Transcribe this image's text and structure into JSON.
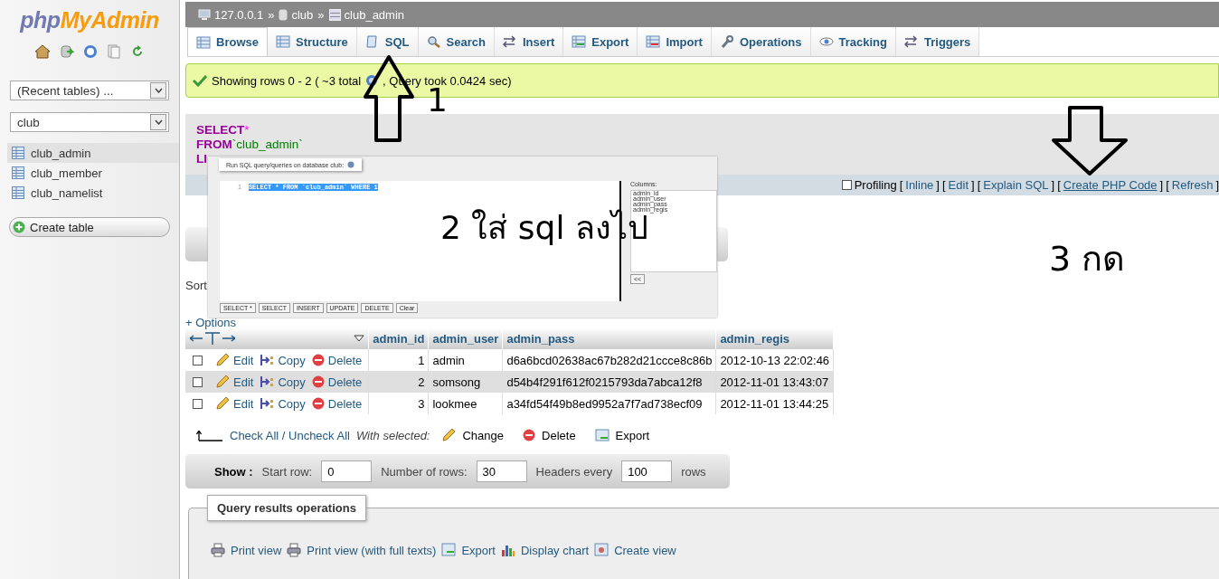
{
  "sidebar": {
    "logo": [
      "php",
      "MyAdmin"
    ],
    "recent_tables": "(Recent tables) ...",
    "database": "club",
    "tables": [
      {
        "name": "club_admin",
        "selected": true
      },
      {
        "name": "club_member",
        "selected": false
      },
      {
        "name": "club_namelist",
        "selected": false
      }
    ],
    "create_table": "Create table"
  },
  "breadcrumb": {
    "separator": "»",
    "items": [
      "127.0.0.1",
      "club",
      "club_admin"
    ]
  },
  "tabs": [
    {
      "label": "Browse",
      "selected": true
    },
    {
      "label": "Structure",
      "selected": false
    },
    {
      "label": "SQL",
      "selected": false
    },
    {
      "label": "Search",
      "selected": false
    },
    {
      "label": "Insert",
      "selected": false
    },
    {
      "label": "Export",
      "selected": false
    },
    {
      "label": "Import",
      "selected": false
    },
    {
      "label": "Operations",
      "selected": false
    },
    {
      "label": "Tracking",
      "selected": false
    },
    {
      "label": "Triggers",
      "selected": false
    }
  ],
  "message": {
    "before": "Showing rows 0 - 2 ( ~3 total",
    "after": ", Query took 0.0424 sec)"
  },
  "sql": {
    "lines": [
      {
        "keyword": "SELECT",
        "rest": "*"
      },
      {
        "keyword": "FROM",
        "rest": "`club_admin`"
      },
      {
        "keyword": "LI"
      }
    ],
    "profiling": {
      "label": "Profiling",
      "checked": false
    },
    "links": [
      {
        "open": "[",
        "label": "Inline",
        "close": "]"
      },
      {
        "open": "[",
        "label": "Edit",
        "close": "]"
      },
      {
        "open": "[",
        "label": "Explain SQL",
        "close": "]"
      },
      {
        "open": "[",
        "label": "Create PHP Code",
        "close": "]"
      },
      {
        "open": "[",
        "label": "Refresh",
        "close": "]"
      }
    ]
  },
  "sort_label": "Sort",
  "options_link": "+ Options",
  "table": {
    "columns": [
      "admin_id",
      "admin_user",
      "admin_pass",
      "admin_regis"
    ],
    "rows": [
      {
        "checked": false,
        "actions": [
          "Edit",
          "Copy",
          "Delete"
        ],
        "cells": [
          "1",
          "admin",
          "d6a6bcd02638ac67b282d21ccce8c86b",
          "2012-10-13 22:02:46"
        ]
      },
      {
        "checked": false,
        "actions": [
          "Edit",
          "Copy",
          "Delete"
        ],
        "cells": [
          "2",
          "somsong",
          "d54b4f291f612f0215793da7abca12f8",
          "2012-11-01 13:43:07"
        ]
      },
      {
        "checked": false,
        "actions": [
          "Edit",
          "Copy",
          "Delete"
        ],
        "cells": [
          "3",
          "lookmee",
          "a34fd54f49b8ed9952a7f7ad738ecf09",
          "2012-11-01 13:44:25"
        ]
      }
    ]
  },
  "bulk": {
    "check_all": "Check All / Uncheck All",
    "with_selected": "With selected:",
    "actions": [
      "Change",
      "Delete",
      "Export"
    ]
  },
  "show_bar": {
    "label": "Show :",
    "start_row_label": "Start row:",
    "start_row": "0",
    "rows_label": "Number of rows:",
    "rows": "30",
    "headers_label": "Headers every",
    "headers": "100",
    "unit": "rows"
  },
  "operations": {
    "legend": "Query results operations",
    "links": [
      "Print view",
      "Print view (with full texts)",
      "Export",
      "Display chart",
      "Create view"
    ]
  },
  "inset": {
    "title": "Run SQL query/queries on database club:",
    "line_number": "1",
    "query": "SELECT * FROM `club_admin` WHERE 1",
    "columns_label": "Columns:",
    "columns": [
      "admin_id",
      "admin_user",
      "admin_pass",
      "admin_regis"
    ],
    "insert_button": "<<",
    "buttons": [
      "SELECT *",
      "SELECT",
      "INSERT",
      "UPDATE",
      "DELETE",
      "Clear"
    ]
  },
  "annotations": [
    "1",
    "2 ใส่ sql ลงไป",
    "3 กด"
  ]
}
